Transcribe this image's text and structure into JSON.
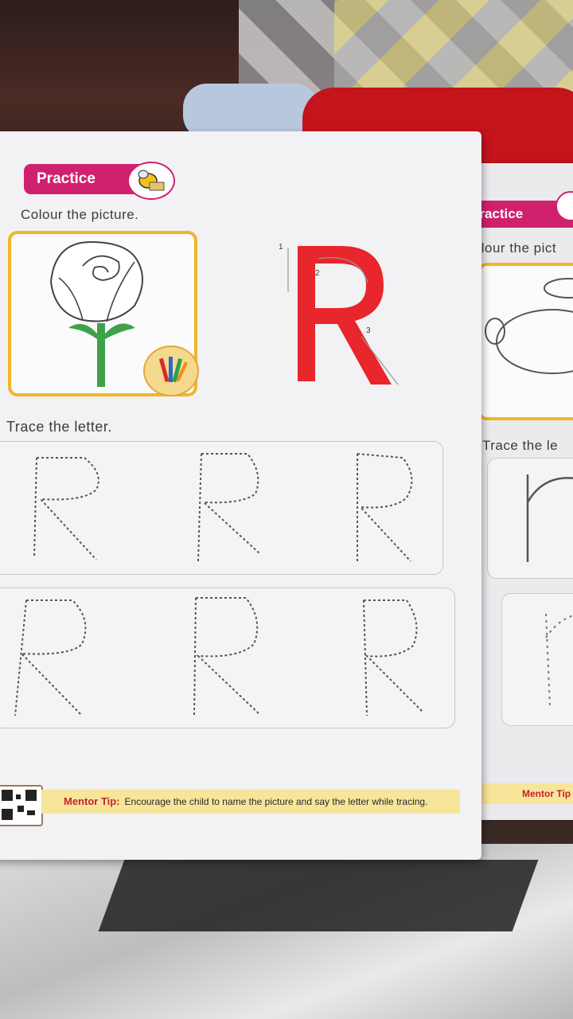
{
  "left_page": {
    "badge": "Practice",
    "instruction_colour": "Colour the picture.",
    "instruction_trace": "Trace the letter.",
    "letter": "R",
    "stroke_numbers": [
      "1",
      "2",
      "3"
    ],
    "mentor_tip_label": "Mentor Tip:",
    "mentor_tip_text": "Encourage the child to name the picture and say the letter while tracing."
  },
  "right_page": {
    "badge": "Practice",
    "instruction_colour": "Colour the pict",
    "instruction_trace": "Trace the le",
    "mentor_tip_label": "Mentor Tip"
  },
  "colors": {
    "badge_pink": "#d0216e",
    "frame_yellow": "#f0b62a",
    "letter_red": "#e8262c",
    "tip_bar": "#f7e59a",
    "tip_label_red": "#c5232d"
  },
  "icons": [
    "bee-mascot-icon",
    "rose-drawing",
    "paintbrush-icon",
    "qr-code"
  ]
}
